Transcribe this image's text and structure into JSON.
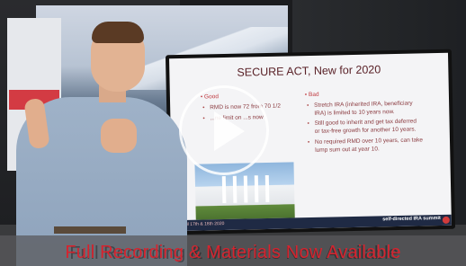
{
  "video": {
    "slide": {
      "title": "SECURE ACT, New for 2020",
      "good": {
        "heading": "• Good",
        "bullets": [
          "RMD is now 72 from 70 1/2",
          "...ne limit on ...s now"
        ]
      },
      "bad": {
        "heading": "• Bad",
        "bullets": [
          "Stretch IRA (inherited IRA, beneficiary IRA) is limited to 10 years now.",
          "Still good to inherit and get tax deferred or tax-free growth for another 10 years.",
          "No required RMD over 10 years, can take lump sum out at year 10."
        ]
      },
      "footer_left": "April 17th & 18th 2020",
      "footer_right": "self-directed IRA summit"
    },
    "banner_text": "Full Recording & Materials Now Available",
    "colors": {
      "banner_text": "#d6232e",
      "slide_heading": "#5a2228"
    },
    "play_icon": "play-icon"
  }
}
